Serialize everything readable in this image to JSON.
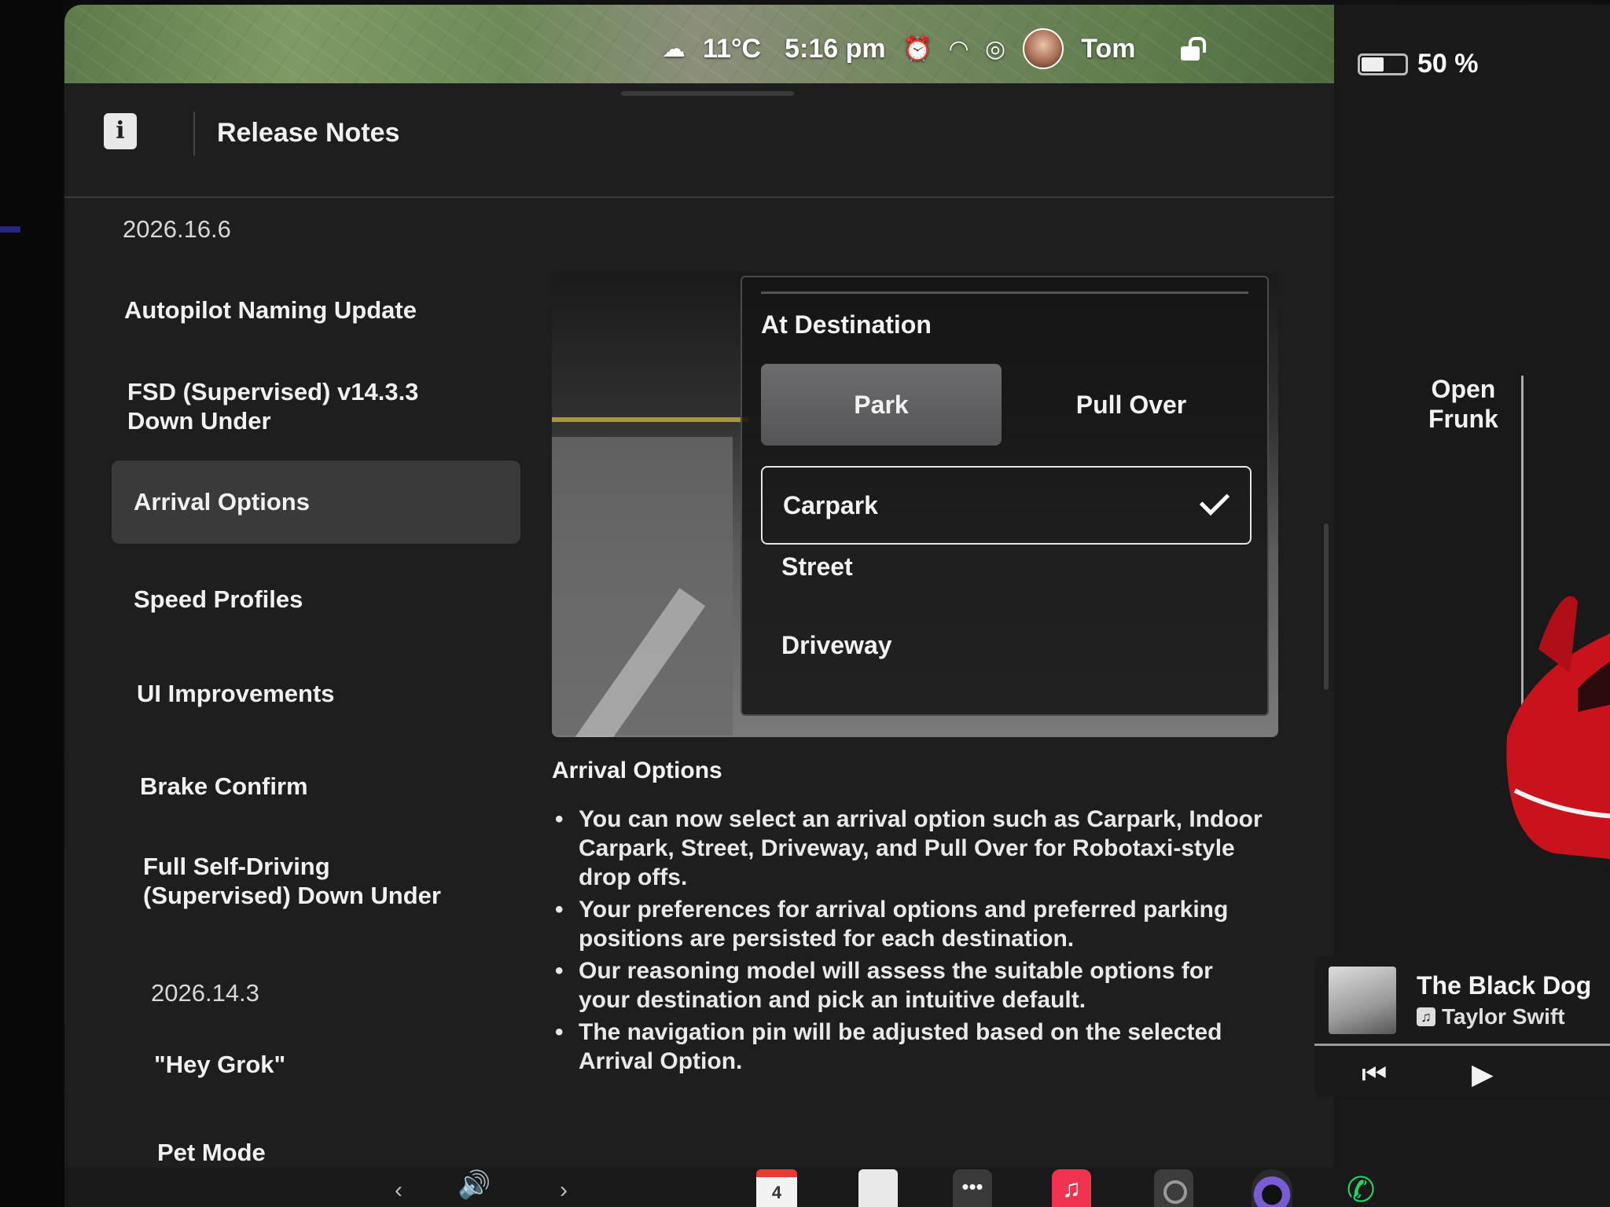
{
  "status": {
    "temperature": "11°C",
    "time": "5:16 pm",
    "user": "Tom",
    "battery_percent": "50 %",
    "battery_level": 0.5,
    "icons": [
      "cloud-icon",
      "alarm-icon",
      "wifi-icon",
      "record-icon",
      "avatar",
      "lock-icon"
    ]
  },
  "panel": {
    "title": "Release Notes",
    "icon": "notes-icon"
  },
  "sidebar": {
    "version_1": "2026.16.6",
    "items": [
      {
        "label": "Autopilot Naming Update"
      },
      {
        "label": "FSD (Supervised) v14.3.3 Down Under"
      },
      {
        "label": "Arrival Options"
      },
      {
        "label": "Speed Profiles"
      },
      {
        "label": "UI Improvements"
      },
      {
        "label": "Brake Confirm"
      },
      {
        "label": "Full Self-Driving (Supervised) Down Under"
      }
    ],
    "version_2": "2026.14.3",
    "items_2": [
      {
        "label": "\"Hey Grok\""
      },
      {
        "label": "Pet Mode"
      }
    ]
  },
  "destination_card": {
    "title": "At Destination",
    "segments": [
      "Park",
      "Pull Over"
    ],
    "selected_segment": "Park",
    "options": [
      "Carpark",
      "Street",
      "Driveway"
    ],
    "selected_option": "Carpark"
  },
  "content": {
    "section_title": "Arrival Options",
    "bullets": [
      "You can now select an arrival option such as Carpark, Indoor Carpark, Street, Driveway, and Pull Over for Robotaxi-style drop offs.",
      "Your preferences for arrival options and preferred parking positions are persisted for each destination.",
      "Our reasoning model will assess the suitable options for your destination and pick an intuitive default.",
      "The navigation pin will be adjusted based on the selected Arrival Option."
    ]
  },
  "car": {
    "frunk_label_line1": "Open",
    "frunk_label_line2": "Frunk",
    "color": "#d3141c"
  },
  "media": {
    "song": "The Black Dog",
    "artist": "Taylor Swift",
    "controls": [
      "previous-icon",
      "play-icon",
      "next-icon"
    ]
  },
  "dock": {
    "calendar_day": "4",
    "items": [
      "volume-icon",
      "calendar-icon",
      "notes-app-icon",
      "more-apps-icon",
      "music-app-icon",
      "camera-app-icon",
      "round-app-icon",
      "phone-icon"
    ]
  },
  "colors": {
    "accent_alarm": "#f5b316",
    "car_red": "#d3141c",
    "music_app": "#f0344f",
    "phone_green": "#25d366"
  }
}
